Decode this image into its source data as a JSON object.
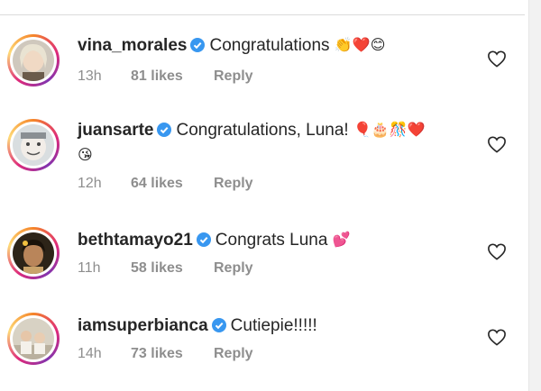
{
  "comments": [
    {
      "username": "vina_morales",
      "text": "Congratulations",
      "emoji": "👏❤️😊",
      "cont": "",
      "time": "13h",
      "likes": "81 likes",
      "reply": "Reply"
    },
    {
      "username": "juansarte",
      "text": "Congratulations, Luna!",
      "emoji": "🎈🎂🎊❤️",
      "cont": "😘",
      "time": "12h",
      "likes": "64 likes",
      "reply": "Reply"
    },
    {
      "username": "bethtamayo21",
      "text": "Congrats Luna",
      "emoji": "💕",
      "cont": "",
      "time": "11h",
      "likes": "58 likes",
      "reply": "Reply"
    },
    {
      "username": "iamsuperbianca",
      "text": "Cutiepie!!!!!",
      "emoji": "",
      "cont": "",
      "time": "14h",
      "likes": "73 likes",
      "reply": "Reply"
    }
  ],
  "icons": {
    "verified": "verified-badge-icon",
    "like": "heart-outline-icon"
  },
  "colors": {
    "verified": "#3897f0",
    "meta": "#8e8e8e",
    "text": "#262626"
  }
}
